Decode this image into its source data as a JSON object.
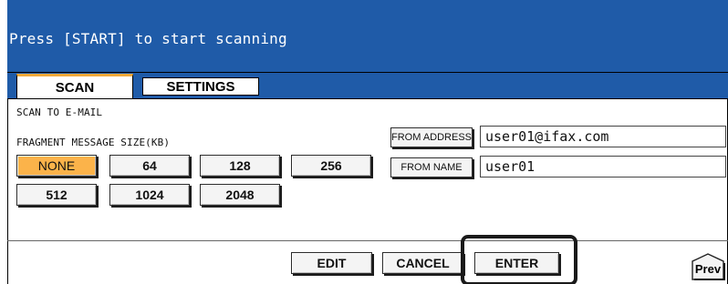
{
  "header": {
    "message": "Press [START] to start scanning"
  },
  "tabs": [
    {
      "label": "SCAN",
      "active": true
    },
    {
      "label": "SETTINGS",
      "active": false
    }
  ],
  "main": {
    "section_title": "SCAN TO E-MAIL",
    "fragment_label": "FRAGMENT MESSAGE SIZE(KB)",
    "fragment_options": [
      "NONE",
      "64",
      "128",
      "256",
      "512",
      "1024",
      "2048"
    ],
    "fragment_selected": "NONE",
    "from_address": {
      "button_label": "FROM ADDRESS",
      "value": "user01@ifax.com"
    },
    "from_name": {
      "button_label": "FROM NAME",
      "value": "user01"
    }
  },
  "footer": {
    "edit_label": "EDIT",
    "cancel_label": "CANCEL",
    "enter_label": "ENTER",
    "prev_label": "Prev"
  },
  "colors": {
    "header_bg": "#1f5ba8",
    "selected_button": "#fbb34a",
    "active_tab_accent": "#f3a93a"
  }
}
